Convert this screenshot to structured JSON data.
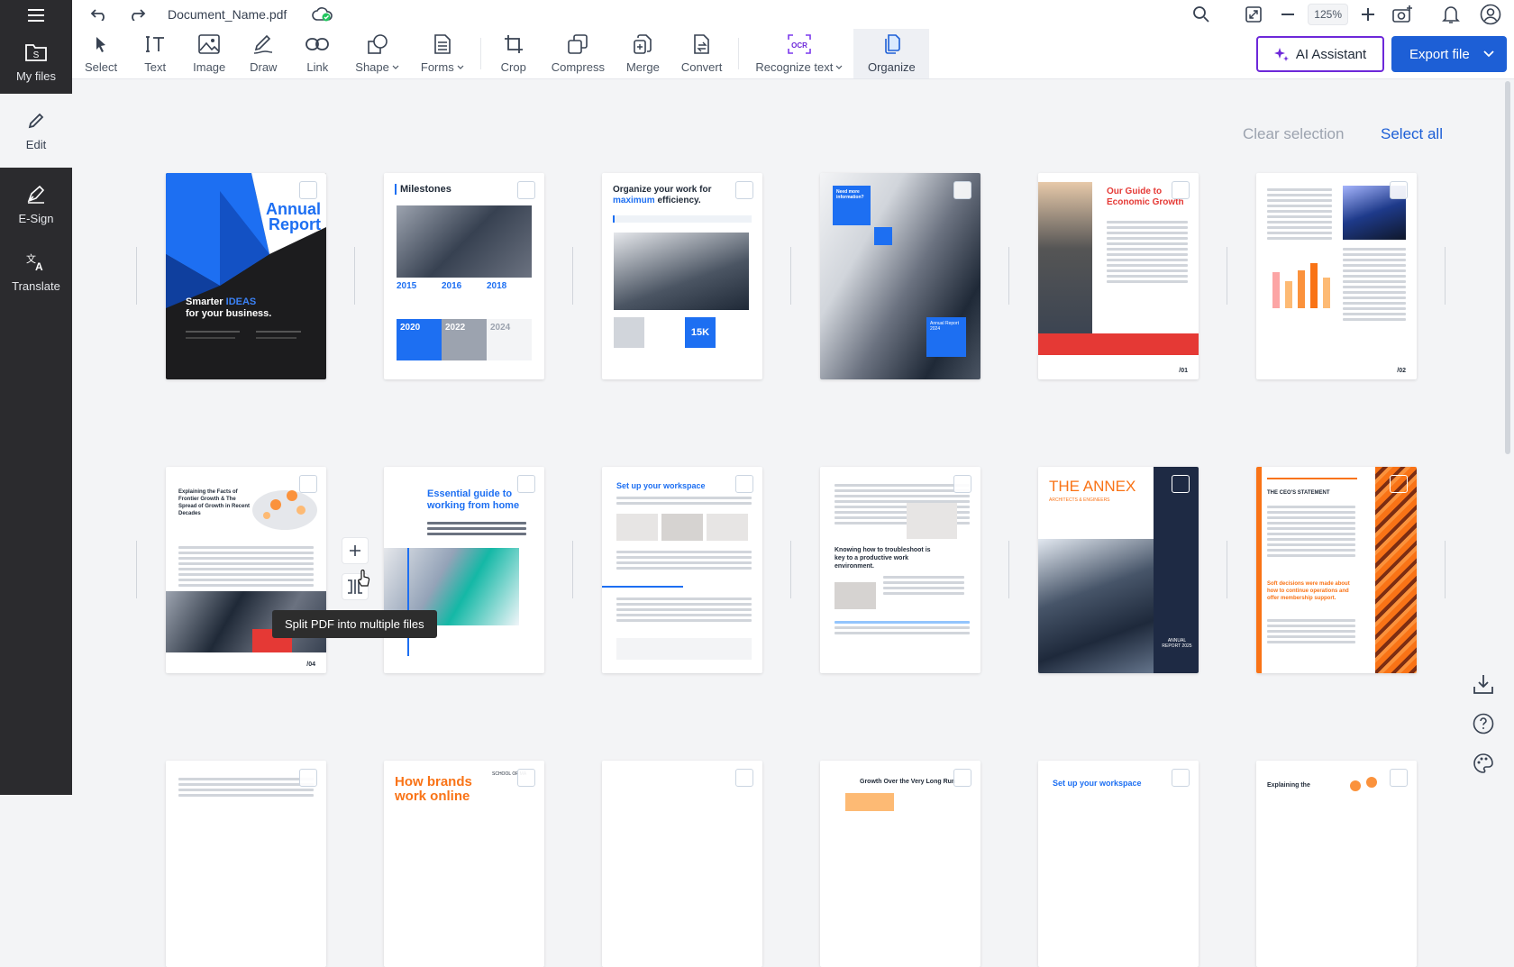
{
  "sidebar": {
    "menu_icon": "hamburger-icon",
    "items": [
      {
        "label": "My files",
        "icon": "folder-s-icon"
      },
      {
        "label": "Edit",
        "icon": "pencil-icon"
      },
      {
        "label": "E-Sign",
        "icon": "pen-nib-icon"
      },
      {
        "label": "Translate",
        "icon": "translate-icon"
      }
    ]
  },
  "topbar": {
    "doc_name": "Document_Name.pdf",
    "zoom": "125%"
  },
  "toolbar": {
    "tools": [
      {
        "label": "Select"
      },
      {
        "label": "Text"
      },
      {
        "label": "Image"
      },
      {
        "label": "Draw"
      },
      {
        "label": "Link"
      },
      {
        "label": "Shape"
      },
      {
        "label": "Forms"
      },
      {
        "label": "Crop"
      },
      {
        "label": "Compress"
      },
      {
        "label": "Merge"
      },
      {
        "label": "Convert"
      },
      {
        "label": "Recognize text"
      },
      {
        "label": "Organize"
      }
    ],
    "ai_label": "AI Assistant",
    "export_label": "Export file"
  },
  "selection": {
    "clear": "Clear selection",
    "select_all": "Select all"
  },
  "tooltip": "Split PDF into multiple files",
  "pages": {
    "p1": {
      "title": "Annual Report",
      "sub1": "Smarter",
      "sub_hl": "IDEAS",
      "sub2": "for your business."
    },
    "p2": {
      "title": "Milestones",
      "y1": "2015",
      "y2": "2016",
      "y3": "2018",
      "y4": "2020",
      "y5": "2022",
      "y6": "2024"
    },
    "p3": {
      "title1": "Organize your work for",
      "title_hl": "maximum",
      "title2": "efficiency.",
      "stat": "15K"
    },
    "p4": {
      "box": "Need more information?",
      "small": "Annual Report 2024"
    },
    "p5": {
      "title": "Our Guide to Economic Growth",
      "page": "/01"
    },
    "p6": {
      "page": "/02"
    },
    "p7": {
      "title": "Explaining the Facts of Frontier Growth & The Spread of Growth in Recent Decades",
      "page": "/04"
    },
    "p8": {
      "title": "Essential guide to working from home"
    },
    "p9": {
      "title": "Set up your workspace"
    },
    "p10": {
      "title": "Knowing how to troubleshoot is key to a productive work environment."
    },
    "p11": {
      "title": "THE ANNEX",
      "sub": "ARCHITECTS & ENGINEERS",
      "badge": "ANNUAL REPORT 2025"
    },
    "p12": {
      "title": "THE CEO'S STATEMENT",
      "quote": "Soft decisions were made about how to continue operations and offer membership support."
    },
    "p13": {},
    "p14": {
      "title": "How brands work online",
      "badge": "SCHOOL OF MA"
    },
    "p15": {},
    "p16": {
      "title": "Growth Over the Very Long Run"
    },
    "p17": {
      "title": "Set up your workspace"
    },
    "p18": {
      "title": "Explaining the"
    }
  },
  "colors": {
    "brand_blue": "#1d5fd6",
    "ai_purple": "#6d28d9",
    "sidebar_bg": "#2b2b2e",
    "accent_orange": "#f97316",
    "accent_red": "#e53935"
  }
}
